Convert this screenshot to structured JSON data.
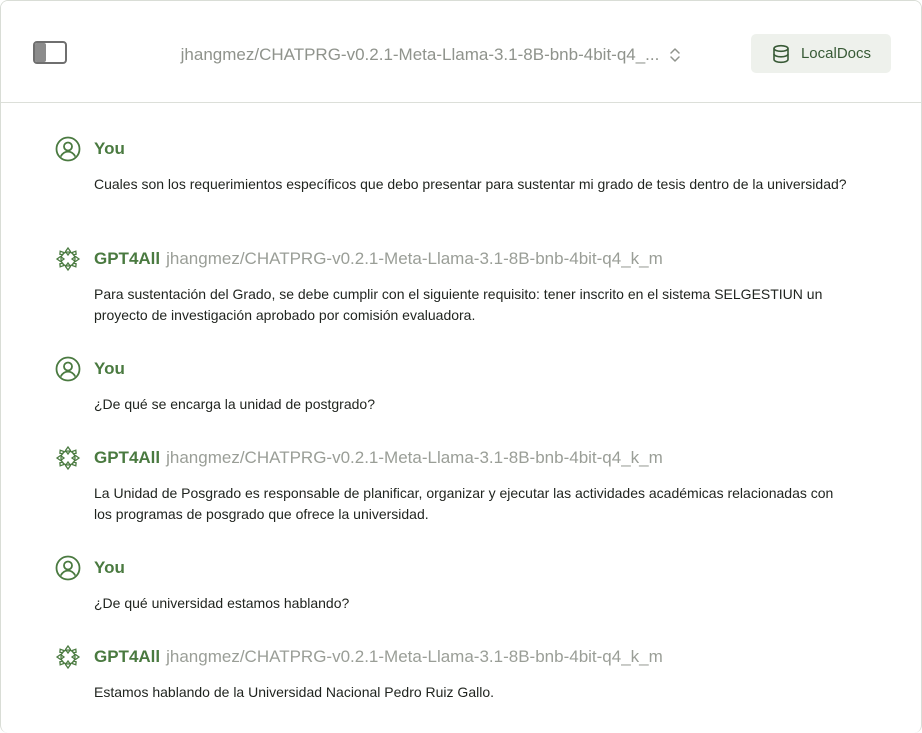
{
  "header": {
    "model_name": "jhangmez/CHATPRG-v0.2.1-Meta-Llama-3.1-8B-bnb-4bit-q4_...",
    "localdocs_label": "LocalDocs"
  },
  "colors": {
    "accent_green": "#4a7a40",
    "muted_gray": "#9a9e97",
    "button_bg": "#eef1ec"
  },
  "icons": {
    "sidebar_toggle": "sidebar-toggle-icon",
    "model_chevron": "chevron-up-down-icon",
    "localdocs": "database-icon",
    "user_avatar": "user-circle-icon",
    "assistant_avatar": "gpt4all-logo-icon"
  },
  "messages": [
    {
      "author": "You",
      "model": "",
      "text": "Cuales son los requerimientos específicos que debo presentar para sustentar mi grado de tesis dentro de la universidad?"
    },
    {
      "author": "GPT4All",
      "model": "jhangmez/CHATPRG-v0.2.1-Meta-Llama-3.1-8B-bnb-4bit-q4_k_m",
      "text": "Para sustentación del Grado, se debe cumplir con el siguiente requisito: tener inscrito en el sistema SELGESTIUN un proyecto de investigación aprobado por comisión evaluadora."
    },
    {
      "author": "You",
      "model": "",
      "text": "¿De qué se encarga la unidad de postgrado?"
    },
    {
      "author": "GPT4All",
      "model": "jhangmez/CHATPRG-v0.2.1-Meta-Llama-3.1-8B-bnb-4bit-q4_k_m",
      "text": "La Unidad de Posgrado es responsable de planificar, organizar y ejecutar las actividades académicas relacionadas con los programas de posgrado que ofrece la universidad."
    },
    {
      "author": "You",
      "model": "",
      "text": "¿De qué universidad estamos hablando?"
    },
    {
      "author": "GPT4All",
      "model": "jhangmez/CHATPRG-v0.2.1-Meta-Llama-3.1-8B-bnb-4bit-q4_k_m",
      "text": "Estamos hablando de la Universidad Nacional Pedro Ruiz Gallo."
    }
  ]
}
